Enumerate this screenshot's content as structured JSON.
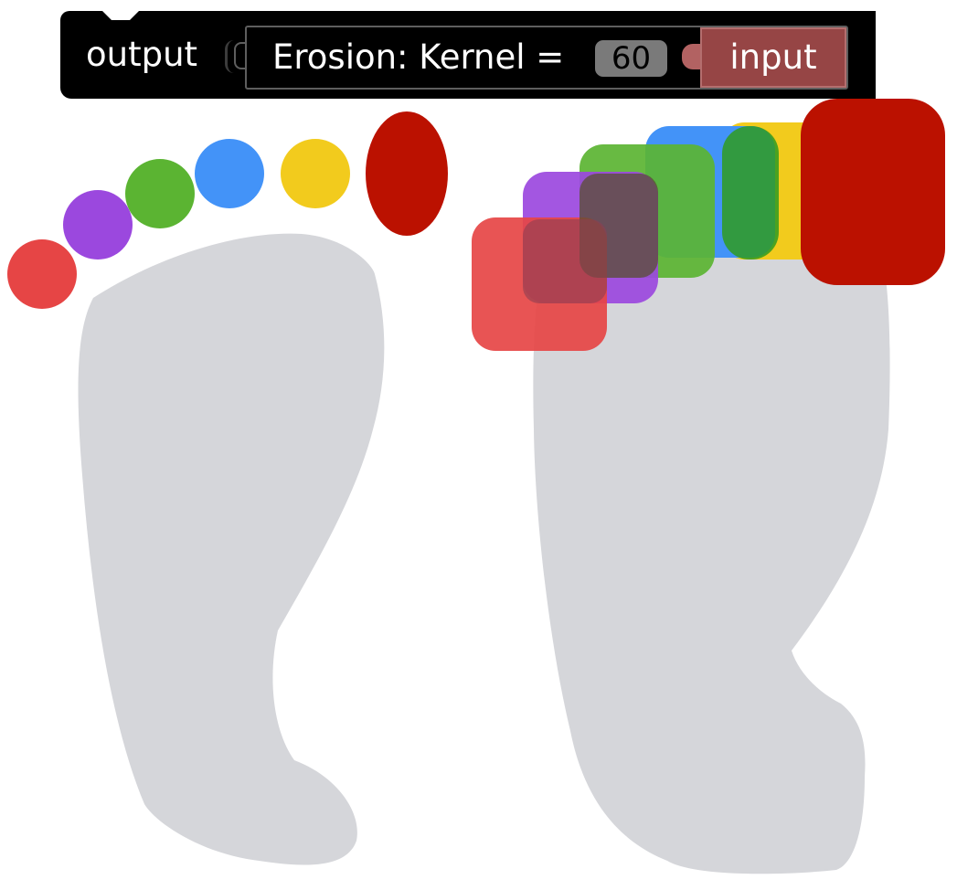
{
  "block": {
    "output_label": "output",
    "operation_label": "Erosion: Kernel =",
    "kernel_value": "60",
    "input_label": "input"
  },
  "colors": {
    "foot": "#d5d6da",
    "red": "#e64545",
    "purple": "#9b48de",
    "green": "#5bb432",
    "blue": "#4393f8",
    "yellow": "#f2cb1d",
    "dark_red": "#bb1100",
    "block_bg": "#000000",
    "input_block": "#964545"
  },
  "images": {
    "left": "original-footprint-icon",
    "right": "eroded-footprint-icon"
  }
}
